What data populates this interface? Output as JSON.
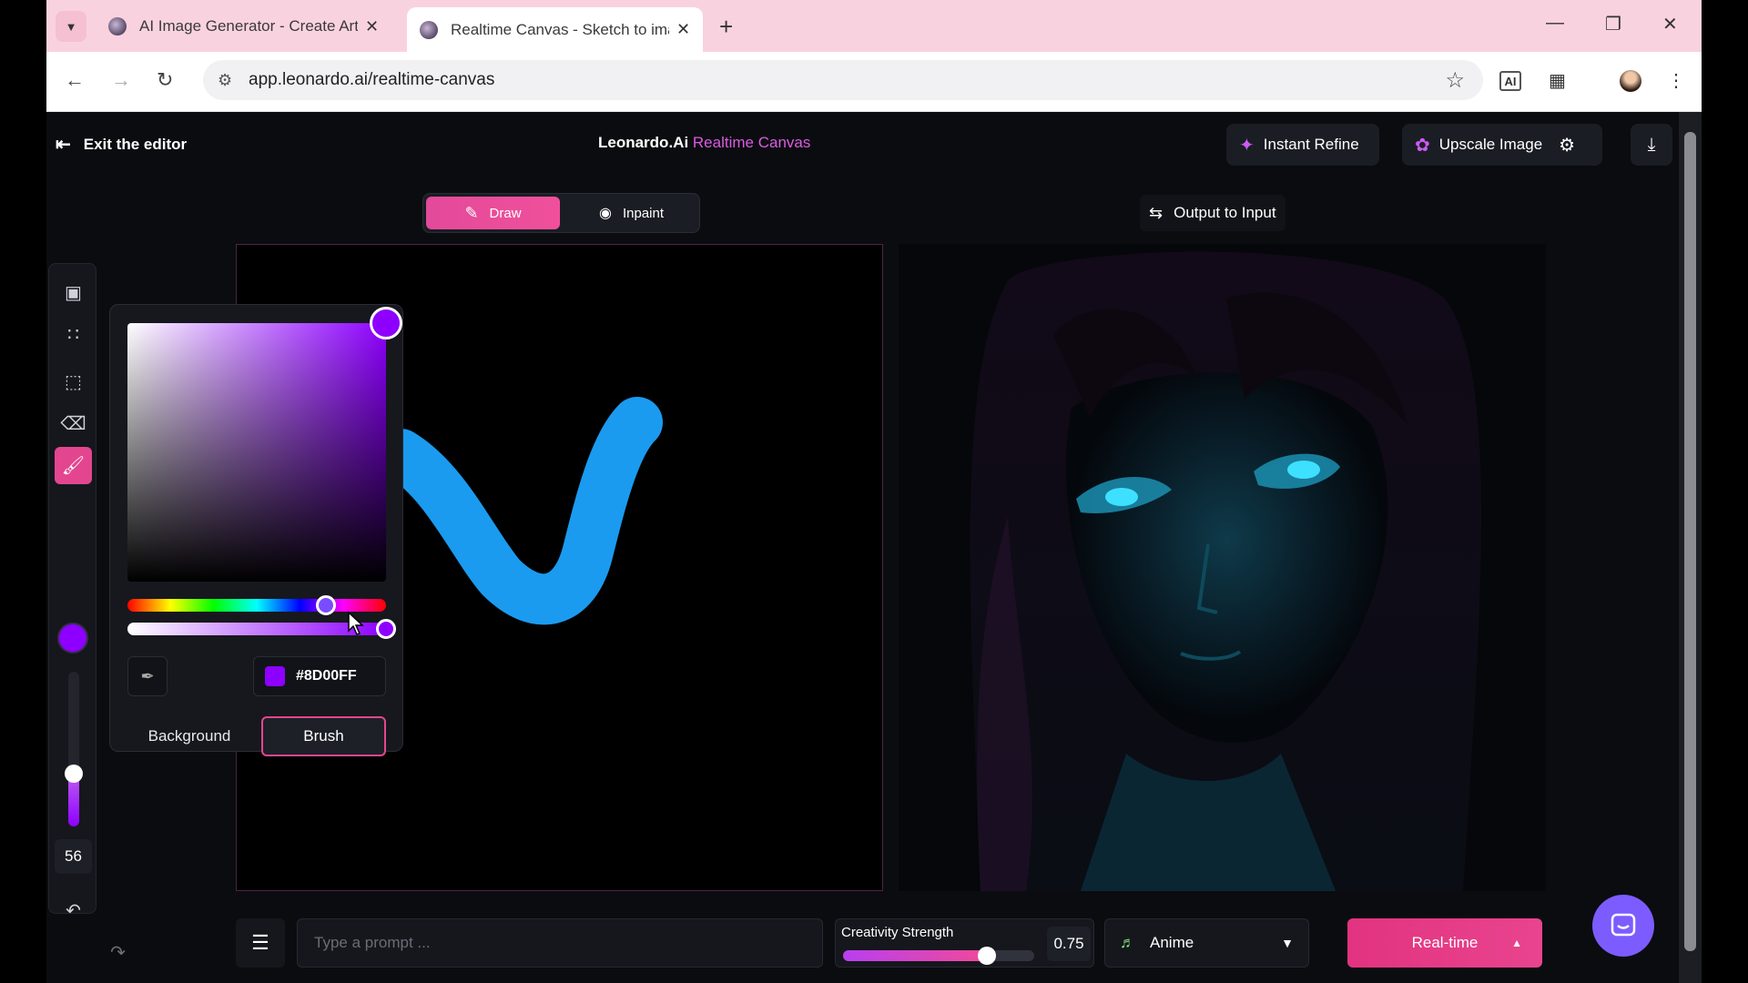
{
  "browser": {
    "tabs": [
      {
        "title": "AI Image Generator - Create Art",
        "active": false
      },
      {
        "title": "Realtime Canvas - Sketch to image",
        "active": true
      }
    ],
    "url": "app.leonardo.ai/realtime-canvas"
  },
  "header": {
    "exit_label": "Exit the editor",
    "brand_name": "Leonardo.Ai",
    "brand_accent": "Realtime Canvas",
    "instant_refine": "Instant Refine",
    "upscale_image": "Upscale Image"
  },
  "modes": {
    "draw": "Draw",
    "inpaint": "Inpaint",
    "active": "Draw"
  },
  "output_to_input": "Output to Input",
  "toolbar": {
    "brush_size": "56",
    "brush_size_level": 0.3,
    "active_tool": "brush",
    "tools": [
      "image-icon",
      "grid-icon",
      "selection-icon",
      "eraser-icon",
      "brush-icon",
      "undo-icon",
      "redo-icon",
      "trash-icon"
    ]
  },
  "color_picker": {
    "hex": "#8D00FF",
    "background_label": "Background",
    "brush_label": "Brush",
    "selected_target": "Brush"
  },
  "prompt": {
    "placeholder": "Type a prompt ...",
    "value": ""
  },
  "creativity": {
    "label": "Creativity Strength",
    "value": "0.75",
    "fraction": 0.75
  },
  "style": {
    "selected": "Anime"
  },
  "generate": {
    "label": "Real-time"
  },
  "colors": {
    "accent": "#e3468f",
    "brush": "#8D00FF",
    "stroke": "#1a9bf0"
  }
}
